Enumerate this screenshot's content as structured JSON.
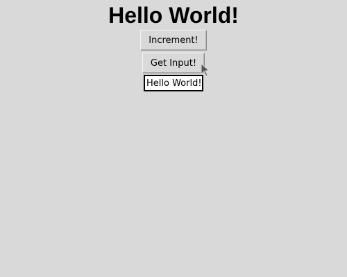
{
  "window": {
    "title": "Hello World!"
  },
  "buttons": {
    "increment_label": "Increment!",
    "get_input_label": "Get Input!"
  },
  "entry": {
    "value": "Hello World!"
  },
  "icons": {
    "cursor": "mouse-pointer-icon"
  },
  "colors": {
    "background": "#d9d9d9",
    "entry_background": "#ffffff",
    "text": "#000000"
  }
}
